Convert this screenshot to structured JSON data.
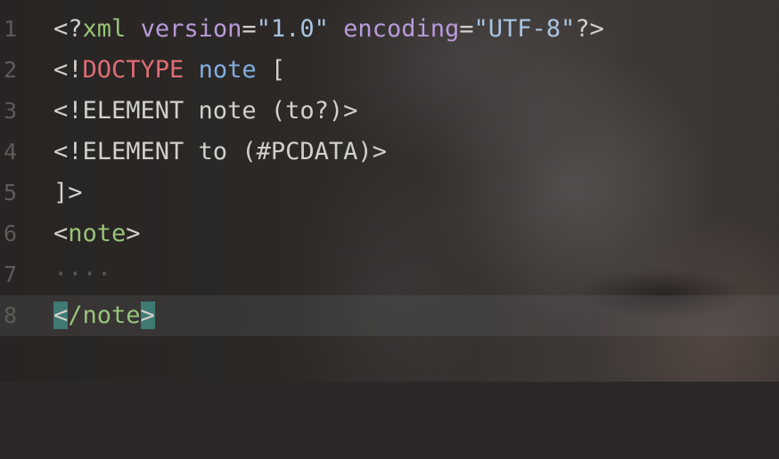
{
  "editor": {
    "lines": [
      {
        "number": "1",
        "tokens": [
          "<?",
          "xml",
          " ",
          "version",
          "=",
          "\"1.0\"",
          " ",
          "encoding",
          "=",
          "\"UTF-8\"",
          "?>"
        ]
      },
      {
        "number": "2",
        "tokens": [
          "<!",
          "DOCTYPE",
          " ",
          "note",
          " ",
          "["
        ]
      },
      {
        "number": "3",
        "text": "<!ELEMENT note (to?)>"
      },
      {
        "number": "4",
        "text": "<!ELEMENT to (#PCDATA)>"
      },
      {
        "number": "5",
        "text": "]>"
      },
      {
        "number": "6",
        "tokens": [
          "<",
          "note",
          ">"
        ]
      },
      {
        "number": "7",
        "whitespace": "····"
      },
      {
        "number": "8",
        "tokens": [
          "<",
          "/note",
          ">"
        ]
      }
    ],
    "current_line": 8
  },
  "colors": {
    "tag": "#98c379",
    "attribute": "#b99ad9",
    "string": "#a8c4e0",
    "keyword": "#e06c75",
    "name": "#82aee0",
    "bracket_highlight": "#3f7a73",
    "line_number": "#5e5a57"
  }
}
